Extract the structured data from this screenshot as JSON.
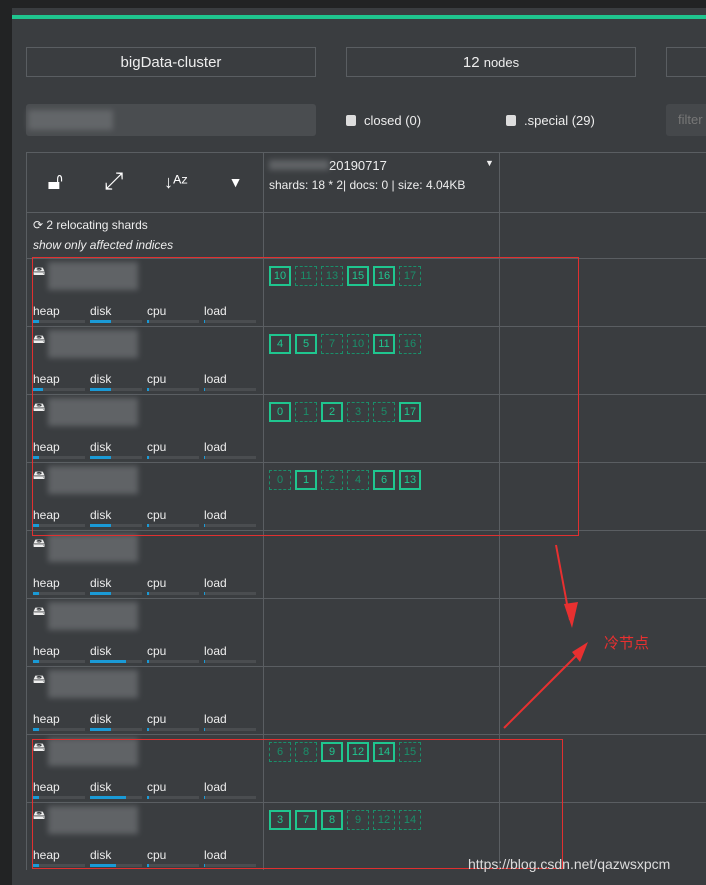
{
  "cluster": {
    "name": "bigData-cluster",
    "nodes_count": "12",
    "nodes_label": "nodes"
  },
  "filters": {
    "closed": "closed (0)",
    "special": ".special (29)",
    "filter_placeholder": "filter"
  },
  "index": {
    "name": "20190717",
    "info": "shards: 18 * 2| docs: 0 | size: 4.04KB"
  },
  "relocating": {
    "label": "2 relocating shards",
    "link": "show only affected indices"
  },
  "metric_labels": [
    "heap",
    "disk",
    "cpu",
    "load"
  ],
  "nodes": [
    {
      "metrics": [
        0.12,
        0.4,
        0.04,
        0.02
      ],
      "shards": [
        {
          "n": "10",
          "primary": true
        },
        {
          "n": "11",
          "primary": false
        },
        {
          "n": "13",
          "primary": false
        },
        {
          "n": "15",
          "primary": true
        },
        {
          "n": "16",
          "primary": true
        },
        {
          "n": "17",
          "primary": false
        }
      ]
    },
    {
      "metrics": [
        0.2,
        0.4,
        0.04,
        0.02
      ],
      "shards": [
        {
          "n": "4",
          "primary": true
        },
        {
          "n": "5",
          "primary": true
        },
        {
          "n": "7",
          "primary": false
        },
        {
          "n": "10",
          "primary": false
        },
        {
          "n": "11",
          "primary": true
        },
        {
          "n": "16",
          "primary": false
        }
      ]
    },
    {
      "metrics": [
        0.12,
        0.4,
        0.04,
        0.02
      ],
      "shards": [
        {
          "n": "0",
          "primary": true
        },
        {
          "n": "1",
          "primary": false
        },
        {
          "n": "2",
          "primary": true
        },
        {
          "n": "3",
          "primary": false
        },
        {
          "n": "5",
          "primary": false
        },
        {
          "n": "17",
          "primary": true
        }
      ]
    },
    {
      "metrics": [
        0.12,
        0.4,
        0.04,
        0.02
      ],
      "shards": [
        {
          "n": "0",
          "primary": false
        },
        {
          "n": "1",
          "primary": true
        },
        {
          "n": "2",
          "primary": false
        },
        {
          "n": "4",
          "primary": false
        },
        {
          "n": "6",
          "primary": true
        },
        {
          "n": "13",
          "primary": true
        }
      ]
    },
    {
      "metrics": [
        0.12,
        0.4,
        0.04,
        0.02
      ],
      "shards": []
    },
    {
      "metrics": [
        0.12,
        0.7,
        0.04,
        0.02
      ],
      "shards": []
    },
    {
      "metrics": [
        0.12,
        0.4,
        0.04,
        0.02
      ],
      "shards": []
    },
    {
      "metrics": [
        0.12,
        0.7,
        0.04,
        0.02
      ],
      "shards": [
        {
          "n": "6",
          "primary": false
        },
        {
          "n": "8",
          "primary": false
        },
        {
          "n": "9",
          "primary": true
        },
        {
          "n": "12",
          "primary": true
        },
        {
          "n": "14",
          "primary": true
        },
        {
          "n": "15",
          "primary": false
        }
      ]
    },
    {
      "metrics": [
        0.12,
        0.5,
        0.04,
        0.02
      ],
      "shards": [
        {
          "n": "3",
          "primary": true
        },
        {
          "n": "7",
          "primary": true
        },
        {
          "n": "8",
          "primary": true
        },
        {
          "n": "9",
          "primary": false
        },
        {
          "n": "12",
          "primary": false
        },
        {
          "n": "14",
          "primary": false
        }
      ]
    }
  ],
  "annotation": {
    "text": "冷节点",
    "color": "#e83030"
  },
  "watermark": "https://blog.csdn.net/qazwsxpcm",
  "colors": {
    "accent": "#1fc68f",
    "bar": "#1a9ad6",
    "bg": "#3a3d40"
  }
}
